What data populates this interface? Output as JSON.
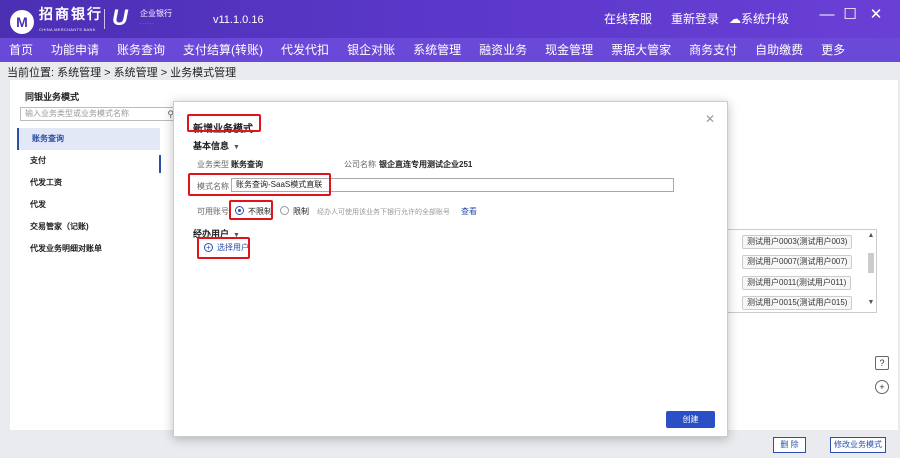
{
  "window": {
    "bank_logo_text": "招商银行",
    "bank_logo_subtext": "CHINA MERCHANTS BANK",
    "enterprise_logo_text": "企业银行",
    "version": "v11.1.0.16",
    "online_service": "在线客服",
    "relogin": "重新登录",
    "upgrade": "系统升级"
  },
  "menu": [
    "首页",
    "功能申请",
    "账务查询",
    "支付结算(转账)",
    "代发代扣",
    "银企对账",
    "系统管理",
    "融资业务",
    "现金管理",
    "票据大管家",
    "商务支付",
    "自助缴费",
    "更多"
  ],
  "breadcrumb": "当前位置: 系统管理 > 系统管理 > 业务模式管理",
  "left_panel": {
    "title": "同银业务模式",
    "search_placeholder": "输入业务类型或业务模式名称",
    "items": [
      {
        "label": "账务查询",
        "active": true
      },
      {
        "label": "支付",
        "active": false
      },
      {
        "label": "代发工资",
        "active": false
      },
      {
        "label": "代发",
        "active": false
      },
      {
        "label": "交易管家（记账)",
        "active": false
      },
      {
        "label": "代发业务明细对账单",
        "active": false
      }
    ]
  },
  "users": [
    "测试用户0003(测试用户003)",
    "测试用户0007(测试用户007)",
    "测试用户0011(测试用户011)",
    "测试用户0015(测试用户015)"
  ],
  "bottom": {
    "delete_label": "删 除",
    "modify_label": "修改业务模式"
  },
  "modal": {
    "title": "新增业务模式",
    "basic_info_section": "基本信息",
    "business_type_label": "业务类型",
    "business_type_value": "账务查询",
    "company_label": "公司名称",
    "company_value": "银企直连专用测试企业251",
    "mode_name_label": "模式名称",
    "mode_name_value": "账务查询-SaaS模式直联",
    "account_label": "可用账号",
    "option_unlimited": "不限制",
    "option_limited": "限制",
    "hint": "经办人可使用该业务下银行允许的全部账号",
    "view_link": "查看",
    "operator_section": "经办用户",
    "select_user": "选择用户",
    "create_button": "创建"
  },
  "colors": {
    "title_bar": "#4b2fb3",
    "menu_bar": "#6a49d8",
    "accent": "#2b4fa8",
    "highlight_red": "#e0151b"
  }
}
